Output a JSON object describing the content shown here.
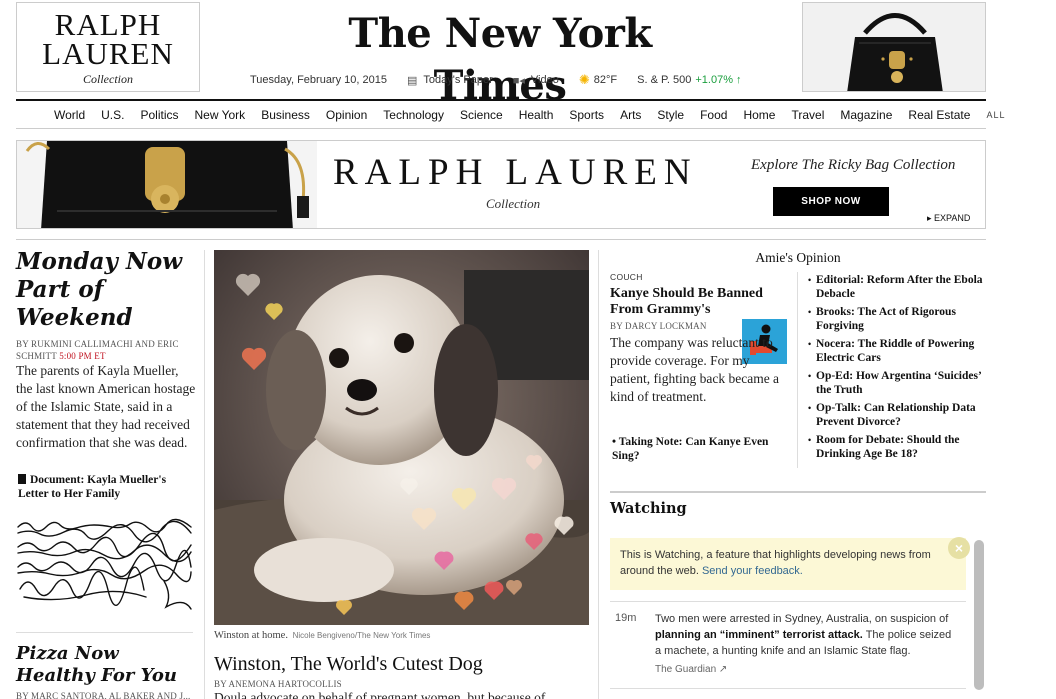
{
  "masthead": {
    "logo_text": "The New York Times",
    "ad_left": {
      "brand_line1": "RALPH",
      "brand_line2": "LAUREN",
      "sub": "Collection"
    },
    "date": "Tuesday, February 10, 2015",
    "todays_paper": "Today's Paper",
    "video": "Video",
    "weather": "82°F",
    "market": "S. & P. 500",
    "market_change": "+1.07% ↑",
    "icons": [
      "newspaper-icon",
      "video-icon",
      "sun-icon"
    ]
  },
  "nav": {
    "items": [
      "World",
      "U.S.",
      "Politics",
      "New York",
      "Business",
      "Opinion",
      "Technology",
      "Science",
      "Health",
      "Sports",
      "Arts",
      "Style",
      "Food",
      "Home",
      "Travel",
      "Magazine",
      "Real Estate"
    ],
    "all_label": "ALL"
  },
  "banner": {
    "brand": "RALPH LAUREN",
    "brand_sub": "Collection",
    "explore": "Explore The Ricky Bag Collection",
    "shop_button": "SHOP NOW",
    "expand": "▸ EXPAND"
  },
  "lead": {
    "headline": "Monday Now Part of Weekend",
    "byline_authors": "By RUKMINI CALLIMACHI and ERIC SCHMITT",
    "byline_time": "5:00 PM ET",
    "summary": "The parents of Kayla Mueller, the last known American hostage of the Islamic State, said in a statement that they had received confirmation that she was dead.",
    "doc_link": "Document: Kayla Mueller's Letter to Her Family"
  },
  "second": {
    "headline": "Pizza Now Healthy For You",
    "byline": "By MARC SANTORA, AL BAKER and J..."
  },
  "center": {
    "caption": "Winston at home.",
    "credit": "Nicole Bengiveno/The New York Times",
    "headline": "Winston, The World's Cutest Dog",
    "byline": "By ANEMONA HARTOCOLLIS",
    "summary": "Doula advocate on behalf of pregnant women, but because of"
  },
  "opinion": {
    "title": "Amie's Opinion",
    "kicker": "COUCH",
    "headline": "Kanye Should Be Banned From Grammy's",
    "byline": "By DARCY LOCKMAN",
    "summary": "The company was reluctant to provide coverage. For my patient, fighting back became a kind of treatment.",
    "note": "Taking Note: Can Kanye Even Sing?",
    "list": [
      "Editorial: Reform After the Ebola Debacle",
      "Brooks: The Act of Rigorous Forgiving",
      "Nocera: The Riddle of Powering Electric Cars",
      "Op-Ed: How Argentina ‘Suicides’ the Truth",
      "Op-Talk: Can Relationship Data Prevent Divorce?",
      "Room for Debate: Should the Drinking Age Be 18?"
    ]
  },
  "watching": {
    "title": "Watching",
    "intro": "This is Watching, a feature that highlights developing news from around the web.",
    "feedback_link": "Send your feedback.",
    "close": "×",
    "item": {
      "time": "19m",
      "text_pre": "Two men were arrested in Sydney, Australia, on suspicion of",
      "text_bold": "planning an “imminent” terrorist attack.",
      "text_post": "The police seized a machete, a hunting knife and an Islamic State flag.",
      "source": "The Guardian ↗"
    }
  }
}
